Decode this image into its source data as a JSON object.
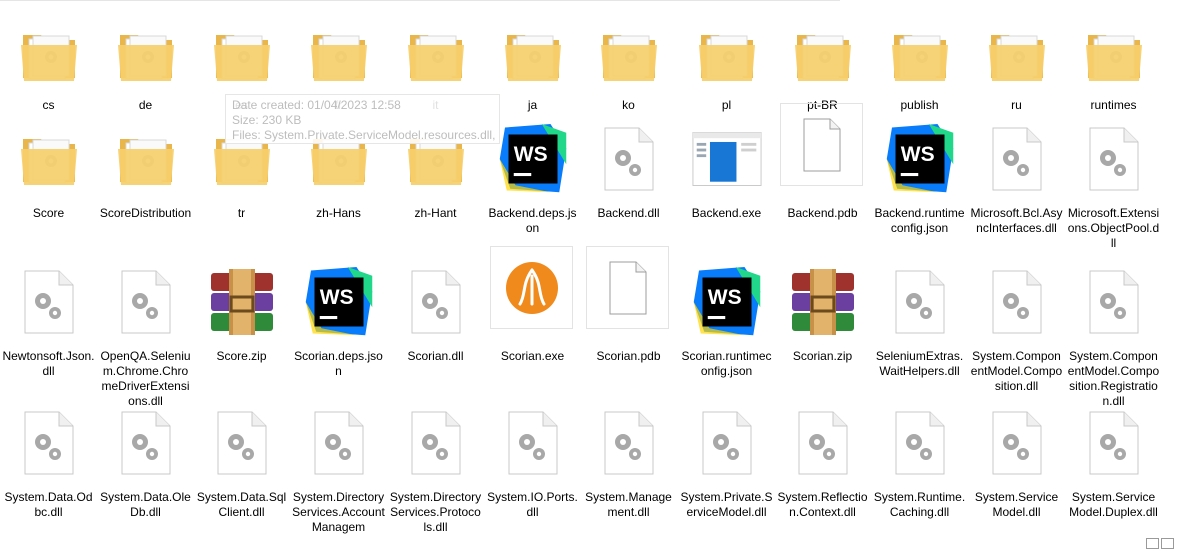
{
  "items": [
    {
      "label": "cs",
      "icon": "folder-icon"
    },
    {
      "label": "de",
      "icon": "folder-icon"
    },
    {
      "label": "es",
      "icon": "folder-icon"
    },
    {
      "label": "fr",
      "icon": "folder-icon"
    },
    {
      "label": "it",
      "icon": "folder-icon"
    },
    {
      "label": "ja",
      "icon": "folder-icon"
    },
    {
      "label": "ko",
      "icon": "folder-icon"
    },
    {
      "label": "pl",
      "icon": "folder-icon"
    },
    {
      "label": "pt-BR",
      "icon": "folder-icon"
    },
    {
      "label": "publish",
      "icon": "folder-icon"
    },
    {
      "label": "ru",
      "icon": "folder-icon"
    },
    {
      "label": "runtimes",
      "icon": "folder-icon"
    },
    {
      "label": "Score",
      "icon": "folder-icon"
    },
    {
      "label": "ScoreDistribution",
      "icon": "folder-icon"
    },
    {
      "label": "tr",
      "icon": "folder-icon"
    },
    {
      "label": "zh-Hans",
      "icon": "folder-icon"
    },
    {
      "label": "zh-Hant",
      "icon": "folder-icon"
    },
    {
      "label": "Backend.deps.json",
      "icon": "webstorm-icon"
    },
    {
      "label": "Backend.dll",
      "icon": "dll-file-icon"
    },
    {
      "label": "Backend.exe",
      "icon": "exe-window-icon"
    },
    {
      "label": "Backend.pdb",
      "icon": "blank-file-icon"
    },
    {
      "label": "Backend.runtimeconfig.json",
      "icon": "webstorm-icon"
    },
    {
      "label": "Microsoft.Bcl.AsyncInterfaces.dll",
      "icon": "dll-file-icon"
    },
    {
      "label": "Microsoft.Extensions.ObjectPool.dll",
      "icon": "dll-file-icon"
    },
    {
      "label": "Newtonsoft.Json.dll",
      "icon": "dll-file-icon"
    },
    {
      "label": "OpenQA.Selenium.Chrome.ChromeDriverExtensions.dll",
      "icon": "dll-file-icon"
    },
    {
      "label": "Score.zip",
      "icon": "winrar-archive-icon"
    },
    {
      "label": "Scorian.deps.json",
      "icon": "webstorm-icon"
    },
    {
      "label": "Scorian.dll",
      "icon": "dll-file-icon"
    },
    {
      "label": "Scorian.exe",
      "icon": "scorian-app-icon"
    },
    {
      "label": "Scorian.pdb",
      "icon": "blank-file-icon"
    },
    {
      "label": "Scorian.runtimeconfig.json",
      "icon": "webstorm-icon"
    },
    {
      "label": "Scorian.zip",
      "icon": "winrar-archive-icon"
    },
    {
      "label": "SeleniumExtras.WaitHelpers.dll",
      "icon": "dll-file-icon"
    },
    {
      "label": "System.ComponentModel.Composition.dll",
      "icon": "dll-file-icon"
    },
    {
      "label": "System.ComponentModel.Composition.Registration.dll",
      "icon": "dll-file-icon"
    },
    {
      "label": "System.Data.Odbc.dll",
      "icon": "dll-file-icon"
    },
    {
      "label": "System.Data.OleDb.dll",
      "icon": "dll-file-icon"
    },
    {
      "label": "System.Data.SqlClient.dll",
      "icon": "dll-file-icon"
    },
    {
      "label": "System.DirectoryServices.AccountManagem",
      "icon": "dll-file-icon"
    },
    {
      "label": "System.DirectoryServices.Protocols.dll",
      "icon": "dll-file-icon"
    },
    {
      "label": "System.IO.Ports.dll",
      "icon": "dll-file-icon"
    },
    {
      "label": "System.Management.dll",
      "icon": "dll-file-icon"
    },
    {
      "label": "System.Private.ServiceModel.dll",
      "icon": "dll-file-icon"
    },
    {
      "label": "System.Reflection.Context.dll",
      "icon": "dll-file-icon"
    },
    {
      "label": "System.Runtime.Caching.dll",
      "icon": "dll-file-icon"
    },
    {
      "label": "System.ServiceModel.dll",
      "icon": "dll-file-icon"
    },
    {
      "label": "System.ServiceModel.Duplex.dll",
      "icon": "dll-file-icon"
    }
  ],
  "tooltip": {
    "line1": "Date created: 01/04/2023 12:58",
    "line2": "Size: 230 KB",
    "line3": "Files: System.Private.ServiceModel.resources.dll, ..."
  },
  "colors": {
    "folder": "#f6cf6b",
    "folder_back": "#e8b64a",
    "webstorm_dark": "#000000",
    "webstorm_blue": "#087cfa",
    "webstorm_cyan": "#21d789",
    "winrar_purple": "#6a3fa0",
    "scorian_orange": "#f08a1c"
  }
}
